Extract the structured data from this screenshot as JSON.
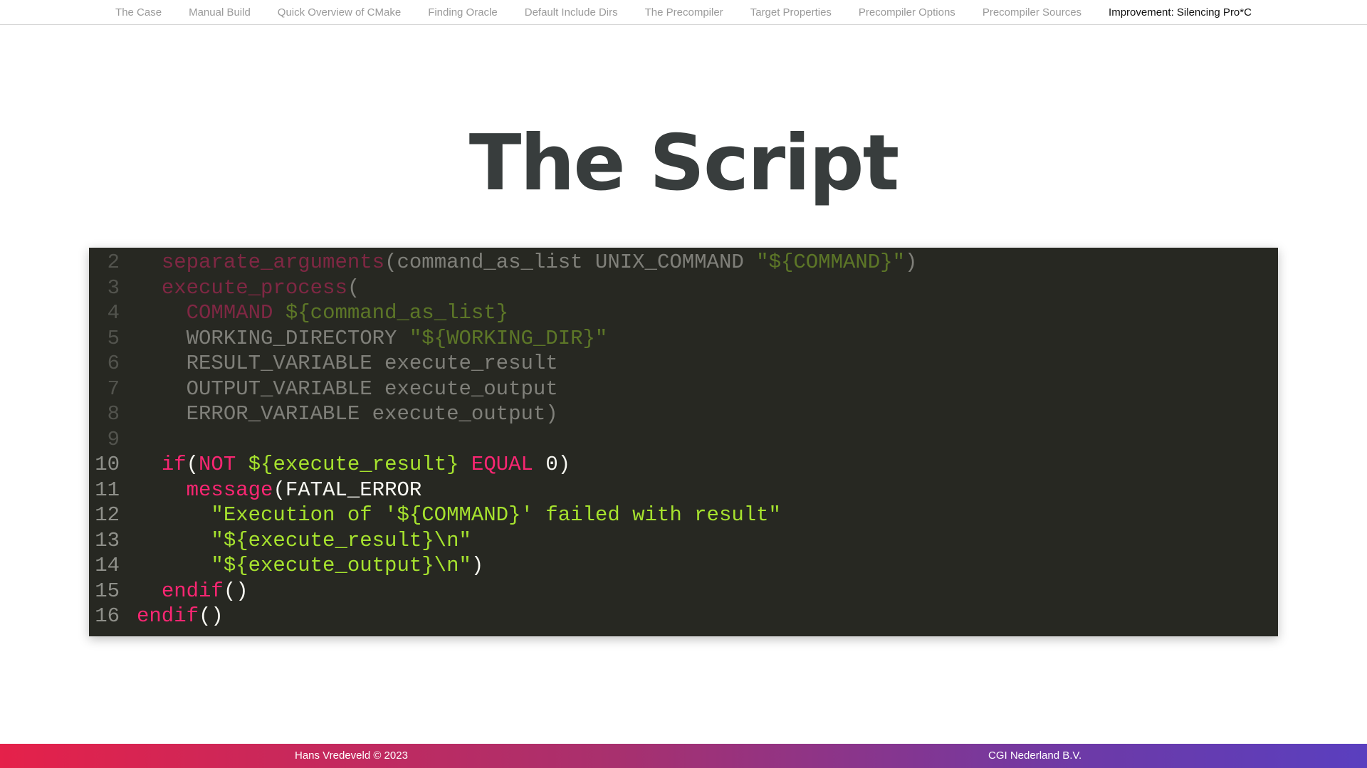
{
  "nav": {
    "items": [
      {
        "label": "The Case",
        "active": false
      },
      {
        "label": "Manual Build",
        "active": false
      },
      {
        "label": "Quick Overview of CMake",
        "active": false
      },
      {
        "label": "Finding Oracle",
        "active": false
      },
      {
        "label": "Default Include Dirs",
        "active": false
      },
      {
        "label": "The Precompiler",
        "active": false
      },
      {
        "label": "Target Properties",
        "active": false
      },
      {
        "label": "Precompiler Options",
        "active": false
      },
      {
        "label": "Precompiler Sources",
        "active": false
      },
      {
        "label": "Improvement: Silencing Pro*C",
        "active": true
      }
    ]
  },
  "slide": {
    "title": "The Script"
  },
  "code": {
    "lines": [
      {
        "num": "2",
        "dim": true,
        "segments": [
          {
            "t": "  ",
            "c": "plain"
          },
          {
            "t": "separate_arguments",
            "c": "kw"
          },
          {
            "t": "(command_as_list UNIX_COMMAND ",
            "c": "plain"
          },
          {
            "t": "\"${COMMAND}\"",
            "c": "str"
          },
          {
            "t": ")",
            "c": "plain"
          }
        ]
      },
      {
        "num": "3",
        "dim": true,
        "segments": [
          {
            "t": "  ",
            "c": "plain"
          },
          {
            "t": "execute_process",
            "c": "kw"
          },
          {
            "t": "(",
            "c": "plain"
          }
        ]
      },
      {
        "num": "4",
        "dim": true,
        "segments": [
          {
            "t": "    ",
            "c": "plain"
          },
          {
            "t": "COMMAND",
            "c": "kw"
          },
          {
            "t": " ",
            "c": "plain"
          },
          {
            "t": "${command_as_list}",
            "c": "str"
          }
        ]
      },
      {
        "num": "5",
        "dim": true,
        "segments": [
          {
            "t": "    WORKING_DIRECTORY ",
            "c": "plain"
          },
          {
            "t": "\"${WORKING_DIR}\"",
            "c": "str"
          }
        ]
      },
      {
        "num": "6",
        "dim": true,
        "segments": [
          {
            "t": "    RESULT_VARIABLE execute_result",
            "c": "plain"
          }
        ]
      },
      {
        "num": "7",
        "dim": true,
        "segments": [
          {
            "t": "    OUTPUT_VARIABLE execute_output",
            "c": "plain"
          }
        ]
      },
      {
        "num": "8",
        "dim": true,
        "segments": [
          {
            "t": "    ERROR_VARIABLE execute_output)",
            "c": "plain"
          }
        ]
      },
      {
        "num": "9",
        "dim": true,
        "segments": []
      },
      {
        "num": "10",
        "dim": false,
        "segments": [
          {
            "t": "  ",
            "c": "plain"
          },
          {
            "t": "if",
            "c": "kw"
          },
          {
            "t": "(",
            "c": "plain"
          },
          {
            "t": "NOT",
            "c": "kw"
          },
          {
            "t": " ",
            "c": "plain"
          },
          {
            "t": "${execute_result}",
            "c": "str"
          },
          {
            "t": " ",
            "c": "plain"
          },
          {
            "t": "EQUAL",
            "c": "kw"
          },
          {
            "t": " 0)",
            "c": "plain"
          }
        ]
      },
      {
        "num": "11",
        "dim": false,
        "segments": [
          {
            "t": "    ",
            "c": "plain"
          },
          {
            "t": "message",
            "c": "kw"
          },
          {
            "t": "(FATAL_ERROR",
            "c": "plain"
          }
        ]
      },
      {
        "num": "12",
        "dim": false,
        "segments": [
          {
            "t": "      ",
            "c": "plain"
          },
          {
            "t": "\"Execution of '${COMMAND}' failed with result\"",
            "c": "str"
          }
        ]
      },
      {
        "num": "13",
        "dim": false,
        "segments": [
          {
            "t": "      ",
            "c": "plain"
          },
          {
            "t": "\"${execute_result}\\n\"",
            "c": "str"
          }
        ]
      },
      {
        "num": "14",
        "dim": false,
        "segments": [
          {
            "t": "      ",
            "c": "plain"
          },
          {
            "t": "\"${execute_output}\\n\"",
            "c": "str"
          },
          {
            "t": ")",
            "c": "plain"
          }
        ]
      },
      {
        "num": "15",
        "dim": false,
        "segments": [
          {
            "t": "  ",
            "c": "plain"
          },
          {
            "t": "endif",
            "c": "kw"
          },
          {
            "t": "()",
            "c": "plain"
          }
        ]
      },
      {
        "num": "16",
        "dim": false,
        "segments": [
          {
            "t": "endif",
            "c": "kw"
          },
          {
            "t": "()",
            "c": "plain"
          }
        ]
      }
    ]
  },
  "footer": {
    "author": "Hans Vredeveld © 2023",
    "company": "CGI Nederland B.V."
  },
  "colors": {
    "keyword": "#f92672",
    "string": "#a6e22e",
    "code_background": "#272822",
    "footer_gradient_start": "#e5214a",
    "footer_gradient_end": "#5a3fbf"
  }
}
